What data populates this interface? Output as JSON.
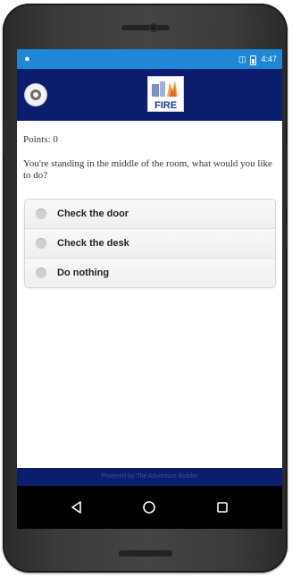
{
  "statusbar": {
    "time": "4:47"
  },
  "appbar": {
    "logo_text": "FIRE"
  },
  "content": {
    "points_label": "Points: 0",
    "prompt": "You're standing in the middle of the room, what would you like to do?",
    "choices": [
      {
        "label": "Check the door"
      },
      {
        "label": "Check the desk"
      },
      {
        "label": "Do nothing"
      }
    ]
  },
  "footer": {
    "text": "Powered by The Adventure Builder"
  },
  "colors": {
    "appbar": "#0b1e6e",
    "statusbar": "#1e88d6"
  }
}
